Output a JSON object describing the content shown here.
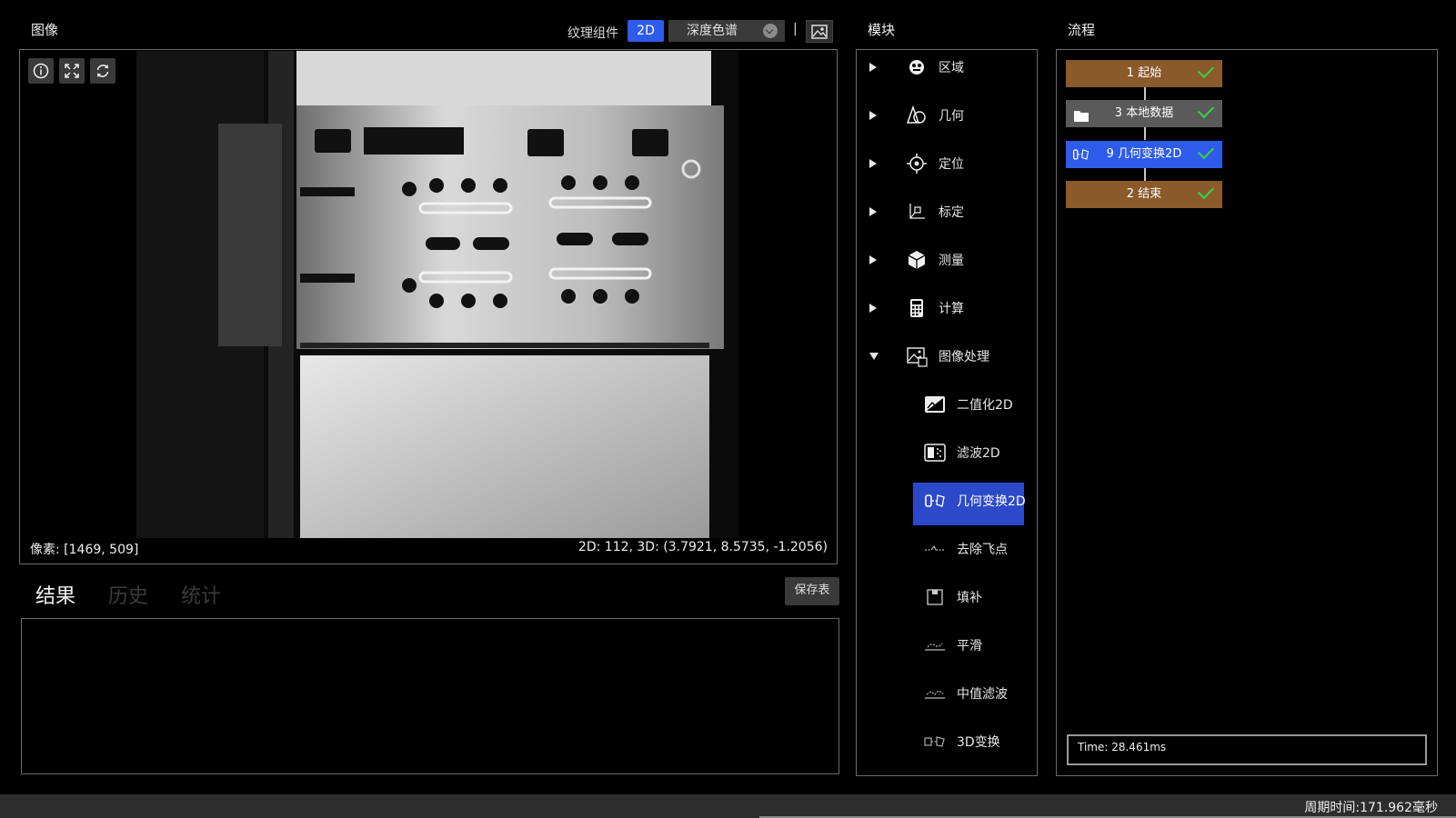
{
  "image_panel": {
    "title": "图像",
    "texture_label": "纹理组件",
    "mode_button": "2D",
    "colormap_select": "深度色谱",
    "separator": "|",
    "pixel_readout": "像素: [1469, 509]",
    "coord_readout": "2D: 112, 3D: (3.7921, 8.5735, -1.2056)",
    "tools": [
      "info-icon",
      "fit-screen-icon",
      "refresh-icon"
    ]
  },
  "results": {
    "tabs": [
      "结果",
      "历史",
      "统计"
    ],
    "active_tab": "结果",
    "save_button": "保存表"
  },
  "modules": {
    "title": "模块",
    "items": [
      {
        "label": "区域",
        "icon": "region-icon",
        "expanded": false
      },
      {
        "label": "几何",
        "icon": "geometry-icon",
        "expanded": false
      },
      {
        "label": "定位",
        "icon": "locate-icon",
        "expanded": false
      },
      {
        "label": "标定",
        "icon": "calibrate-icon",
        "expanded": false
      },
      {
        "label": "测量",
        "icon": "measure-icon",
        "expanded": false
      },
      {
        "label": "计算",
        "icon": "calculator-icon",
        "expanded": false
      },
      {
        "label": "图像处理",
        "icon": "image-processing-icon",
        "expanded": true
      }
    ],
    "subitems": [
      {
        "label": "二值化2D",
        "icon": "binarize-icon"
      },
      {
        "label": "滤波2D",
        "icon": "filter-icon"
      },
      {
        "label": "几何变换2D",
        "icon": "geometric-transform-icon",
        "selected": true
      },
      {
        "label": "去除飞点",
        "icon": "remove-outliers-icon"
      },
      {
        "label": "填补",
        "icon": "fill-icon"
      },
      {
        "label": "平滑",
        "icon": "smooth-icon"
      },
      {
        "label": "中值滤波",
        "icon": "median-filter-icon"
      },
      {
        "label": "3D变换",
        "icon": "transform-3d-icon"
      }
    ]
  },
  "flow": {
    "title": "流程",
    "nodes": [
      {
        "label": "1 起始",
        "color": "#8a5a2a",
        "status": "check-icon"
      },
      {
        "label": "3 本地数据",
        "color": "#5a5a5a",
        "status": "check-icon",
        "icon": "folder-icon"
      },
      {
        "label": "9 几何变换2D",
        "color": "#2f5bea",
        "status": "check-icon",
        "icon": "geometric-transform-icon"
      },
      {
        "label": "2 结束",
        "color": "#8a5a2a",
        "status": "check-icon"
      }
    ],
    "time": "Time: 28.461ms"
  },
  "footer": {
    "cycle_time": "周期时间:171.962毫秒"
  },
  "colors": {
    "accent": "#2f5bea",
    "selected": "#2b49c8",
    "node_brown": "#8a5a2a",
    "check": "#3ad14a"
  }
}
